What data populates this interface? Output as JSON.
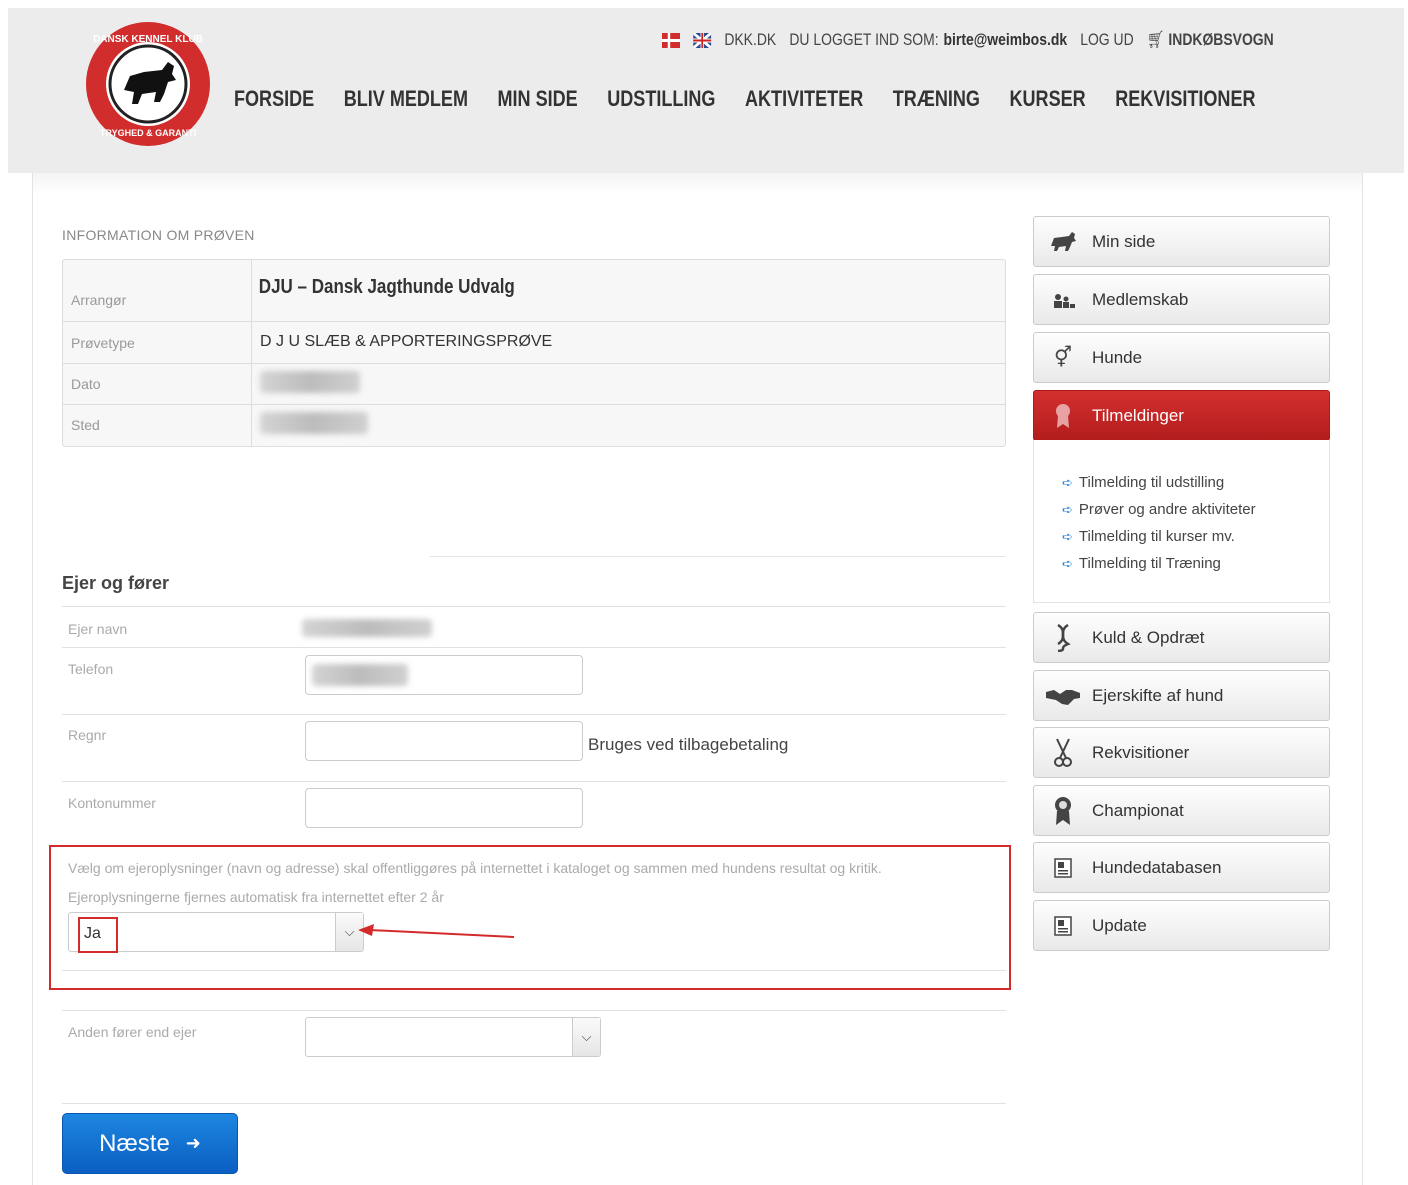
{
  "header": {
    "topbar": {
      "site_link": "DKK.DK",
      "logged_in_prefix": "DU LOGGET IND SOM:",
      "email": "birte@weimbos.dk",
      "logout": "LOG UD",
      "cart": "INDKØBSVOGN"
    },
    "nav": [
      "FORSIDE",
      "BLIV MEDLEM",
      "MIN SIDE",
      "UDSTILLING",
      "AKTIVITETER",
      "TRÆNING",
      "KURSER",
      "REKVISITIONER"
    ],
    "logo_text_top": "DANSK KENNEL KLUB",
    "logo_text_bottom": "TRYGHED & GARANTI"
  },
  "info": {
    "section_title": "INFORMATION OM PRØVEN",
    "rows": [
      {
        "label": "Arrangør",
        "value": "DJU – Dansk Jagthunde Udvalg"
      },
      {
        "label": "Prøvetype",
        "value": "D J U SLÆB & APPORTERINGSPRØVE"
      },
      {
        "label": "Dato",
        "value": ""
      },
      {
        "label": "Sted",
        "value": ""
      }
    ]
  },
  "owner": {
    "title": "Ejer og fører",
    "fields": {
      "owner_name": "Ejer navn",
      "phone": "Telefon",
      "regnr": "Regnr",
      "regnr_hint": "Bruges ved tilbagebetaling",
      "account": "Kontonummer"
    },
    "publish_notice_1": "Vælg om ejeroplysninger (navn og adresse) skal offentliggøres på internettet i kataloget og sammen med hundens resultat og kritik.",
    "publish_notice_2": "Ejeroplysningerne fjernes automatisk fra internettet efter 2 år",
    "publish_value": "Ja",
    "other_handler_label": "Anden fører end ejer",
    "other_handler_value": ""
  },
  "next_button": "Næste",
  "sidebar": {
    "items": [
      {
        "label": "Min side",
        "icon": "dog-icon"
      },
      {
        "label": "Medlemskab",
        "icon": "members-icon"
      },
      {
        "label": "Hunde",
        "icon": "gender-icon"
      },
      {
        "label": "Tilmeldinger",
        "icon": "ribbon-icon",
        "active": true
      },
      {
        "label": "Kuld & Opdræt",
        "icon": "dna-icon"
      },
      {
        "label": "Ejerskifte af hund",
        "icon": "handshake-icon"
      },
      {
        "label": "Rekvisitioner",
        "icon": "scissors-icon"
      },
      {
        "label": "Championat",
        "icon": "award-icon"
      },
      {
        "label": "Hundedatabasen",
        "icon": "database-icon"
      },
      {
        "label": "Update",
        "icon": "database-icon"
      }
    ],
    "submenu": [
      "Tilmelding til udstilling",
      "Prøver og andre aktiviteter",
      "Tilmelding til kurser mv.",
      "Tilmelding til Træning"
    ]
  },
  "colors": {
    "accent_red": "#c62828",
    "button_blue": "#1467cf",
    "header_bg": "#ececec"
  }
}
